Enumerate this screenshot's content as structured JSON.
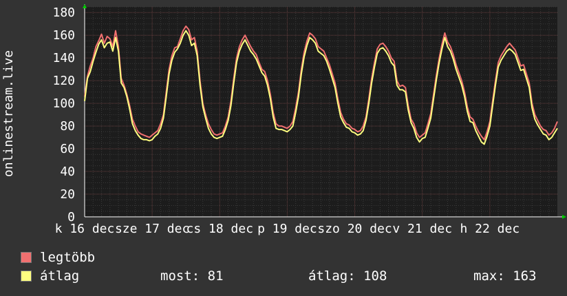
{
  "chart_data": {
    "type": "line",
    "ylabel": "onlinestream.live",
    "ylim": [
      0,
      185
    ],
    "yticks": [
      0,
      20,
      40,
      60,
      80,
      100,
      120,
      140,
      160,
      180
    ],
    "xlim": [
      0,
      7
    ],
    "xticks": [
      {
        "pos": 0.0,
        "label": "k 16 dec"
      },
      {
        "pos": 1.0,
        "label": "sze 17 dec"
      },
      {
        "pos": 2.0,
        "label": "cs 18 dec"
      },
      {
        "pos": 3.0,
        "label": "p 19 dec"
      },
      {
        "pos": 4.0,
        "label": "szo 20 dec"
      },
      {
        "pos": 5.0,
        "label": "v 21 dec"
      },
      {
        "pos": 6.0,
        "label": "h 22 dec"
      }
    ],
    "grid": true,
    "series": [
      {
        "name": "legtöbb",
        "color": "#f07070",
        "values": [
          106,
          124,
          133,
          140,
          150,
          155,
          161,
          153,
          159,
          157,
          150,
          164,
          150,
          122,
          116,
          108,
          98,
          86,
          80,
          75,
          73,
          72,
          71,
          70,
          72,
          74,
          76,
          82,
          90,
          110,
          130,
          142,
          149,
          150,
          157,
          164,
          168,
          165,
          156,
          158,
          146,
          120,
          100,
          90,
          82,
          77,
          73,
          72,
          73,
          74,
          80,
          88,
          102,
          122,
          140,
          150,
          156,
          160,
          155,
          150,
          146,
          143,
          136,
          130,
          128,
          120,
          108,
          92,
          82,
          80,
          80,
          79,
          78,
          80,
          84,
          96,
          110,
          130,
          145,
          155,
          162,
          160,
          157,
          150,
          148,
          146,
          140,
          134,
          126,
          118,
          104,
          92,
          86,
          82,
          81,
          78,
          77,
          75,
          76,
          80,
          88,
          104,
          122,
          136,
          148,
          152,
          153,
          150,
          146,
          140,
          137,
          120,
          115,
          116,
          114,
          98,
          86,
          82,
          74,
          70,
          72,
          74,
          82,
          91,
          108,
          125,
          140,
          152,
          162,
          154,
          150,
          143,
          134,
          127,
          120,
          110,
          97,
          88,
          86,
          80,
          75,
          71,
          68,
          75,
          84,
          102,
          120,
          136,
          142,
          146,
          150,
          153,
          150,
          147,
          140,
          133,
          134,
          126,
          118,
          100,
          90,
          85,
          80,
          77,
          76,
          72,
          74,
          78,
          84
        ]
      },
      {
        "name": "átlag",
        "color": "#ffff80",
        "values": [
          102,
          122,
          128,
          137,
          145,
          152,
          156,
          149,
          153,
          154,
          146,
          158,
          146,
          118,
          114,
          106,
          95,
          82,
          76,
          72,
          69,
          68,
          68,
          67,
          68,
          71,
          73,
          78,
          87,
          106,
          126,
          138,
          145,
          148,
          153,
          160,
          164,
          160,
          151,
          153,
          142,
          116,
          97,
          87,
          78,
          73,
          70,
          69,
          70,
          71,
          77,
          85,
          98,
          118,
          136,
          146,
          152,
          156,
          151,
          146,
          143,
          139,
          133,
          127,
          124,
          116,
          104,
          88,
          78,
          77,
          77,
          76,
          75,
          77,
          80,
          92,
          106,
          126,
          141,
          151,
          158,
          156,
          153,
          146,
          144,
          142,
          137,
          130,
          122,
          114,
          100,
          88,
          83,
          79,
          78,
          75,
          74,
          72,
          73,
          76,
          85,
          100,
          118,
          132,
          144,
          148,
          149,
          146,
          142,
          136,
          133,
          116,
          112,
          112,
          110,
          94,
          83,
          78,
          70,
          66,
          69,
          70,
          78,
          87,
          104,
          121,
          136,
          148,
          158,
          150,
          146,
          139,
          130,
          123,
          116,
          106,
          93,
          84,
          83,
          76,
          71,
          66,
          64,
          71,
          80,
          98,
          116,
          132,
          138,
          142,
          146,
          148,
          146,
          143,
          136,
          129,
          130,
          122,
          114,
          96,
          86,
          81,
          77,
          73,
          72,
          68,
          70,
          74,
          78
        ]
      }
    ]
  },
  "legend": [
    {
      "label": "legtöbb",
      "color": "#f07070"
    },
    {
      "label": "átlag",
      "color": "#ffff80"
    }
  ],
  "stats": {
    "most": "most: 81",
    "atlag": "átlag: 108",
    "max": "max: 163"
  }
}
